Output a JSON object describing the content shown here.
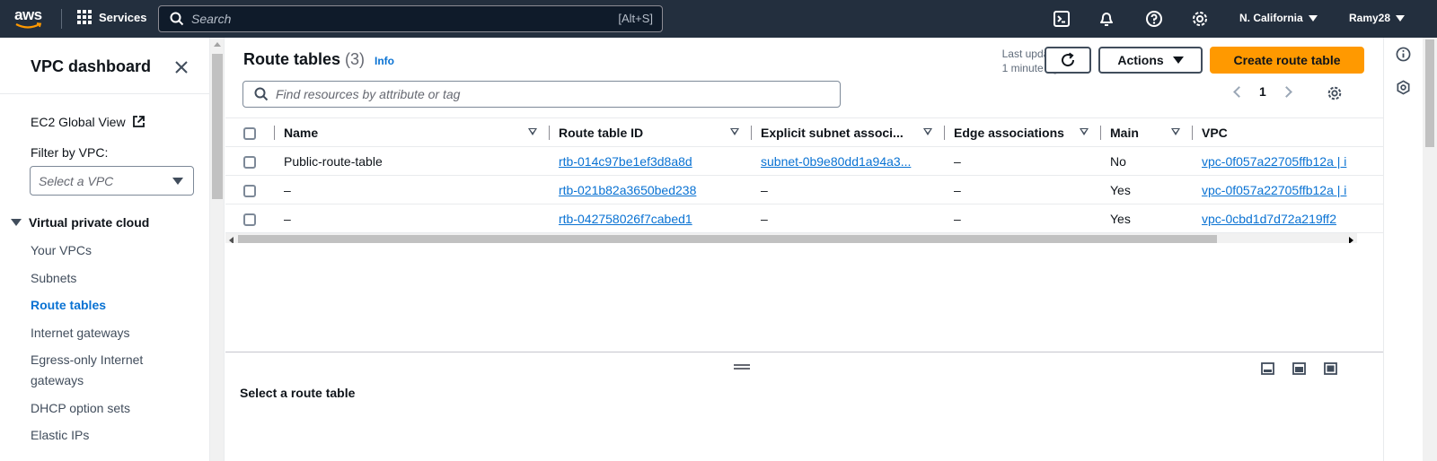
{
  "topnav": {
    "logo": "aws",
    "services_label": "Services",
    "search_placeholder": "Search",
    "search_shortcut": "[Alt+S]",
    "region": "N. California",
    "user": "Ramy28"
  },
  "sidebar": {
    "title": "VPC dashboard",
    "ec2_global_view": "EC2 Global View",
    "filter_label": "Filter by VPC:",
    "select_placeholder": "Select a VPC",
    "section_title": "Virtual private cloud",
    "items": [
      {
        "label": "Your VPCs",
        "active": false
      },
      {
        "label": "Subnets",
        "active": false
      },
      {
        "label": "Route tables",
        "active": true
      },
      {
        "label": "Internet gateways",
        "active": false
      },
      {
        "label": "Egress-only Internet gateways",
        "active": false
      },
      {
        "label": "DHCP option sets",
        "active": false
      },
      {
        "label": "Elastic IPs",
        "active": false
      }
    ]
  },
  "main": {
    "title": "Route tables",
    "count": "(3)",
    "info": "Info",
    "last_updated_label": "Last updated",
    "last_updated_value": "1 minute ago",
    "actions_label": "Actions",
    "create_label": "Create route table",
    "filter_placeholder": "Find resources by attribute or tag",
    "page_number": "1"
  },
  "table": {
    "columns": [
      "Name",
      "Route table ID",
      "Explicit subnet associ...",
      "Edge associations",
      "Main",
      "VPC"
    ],
    "rows": [
      {
        "name": "Public-route-table",
        "id": "rtb-014c97be1ef3d8a8d",
        "subnet": "subnet-0b9e80dd1a94a3...",
        "edge": "–",
        "main": "No",
        "vpc": "vpc-0f057a22705ffb12a | i"
      },
      {
        "name": "–",
        "id": "rtb-021b82a3650bed238",
        "subnet": "–",
        "edge": "–",
        "main": "Yes",
        "vpc": "vpc-0f057a22705ffb12a | i"
      },
      {
        "name": "–",
        "id": "rtb-042758026f7cabed1",
        "subnet": "–",
        "edge": "–",
        "main": "Yes",
        "vpc": "vpc-0cbd1d7d72a219ff2"
      }
    ]
  },
  "split_panel": {
    "title": "Select a route table"
  },
  "colors": {
    "nav_bg": "#232f3e",
    "primary": "#ff9900",
    "link": "#0972d3"
  }
}
